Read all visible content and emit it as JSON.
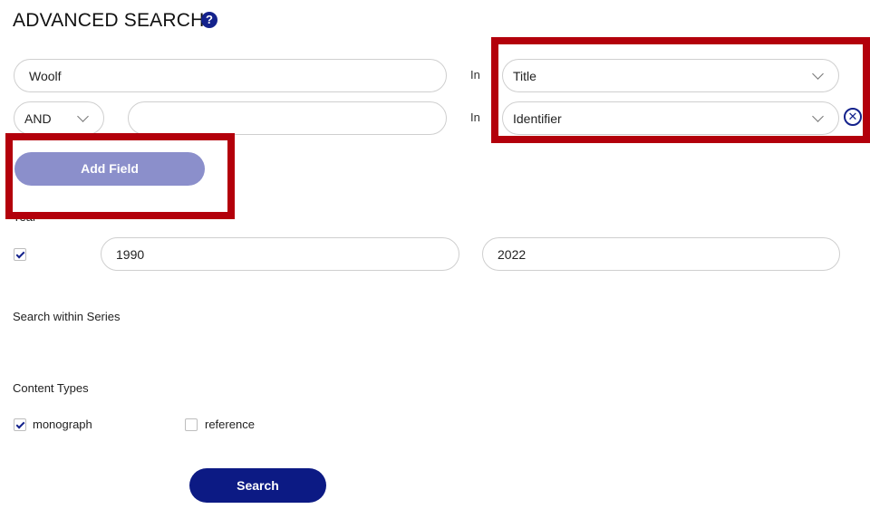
{
  "page": {
    "title": "ADVANCED SEARCH",
    "help_icon": "?"
  },
  "query_rows": [
    {
      "term": "Woolf",
      "in_label": "In",
      "field": "Title"
    },
    {
      "operator": "AND",
      "term": "",
      "in_label": "In",
      "field": "Identifier",
      "remove_icon": "✕"
    }
  ],
  "add_field": {
    "label": "Add Field"
  },
  "year": {
    "label": "Year",
    "enabled": true,
    "from": "1990",
    "to": "2022"
  },
  "series": {
    "label": "Search within Series"
  },
  "content_types": {
    "label": "Content Types",
    "options": [
      {
        "label": "monograph",
        "checked": true
      },
      {
        "label": "reference",
        "checked": false
      }
    ]
  },
  "search_button": {
    "label": "Search"
  },
  "colors": {
    "accent": "#14228c",
    "button_primary": "#0c1a84",
    "button_secondary": "#8b8fcb",
    "highlight": "#b3000b"
  }
}
